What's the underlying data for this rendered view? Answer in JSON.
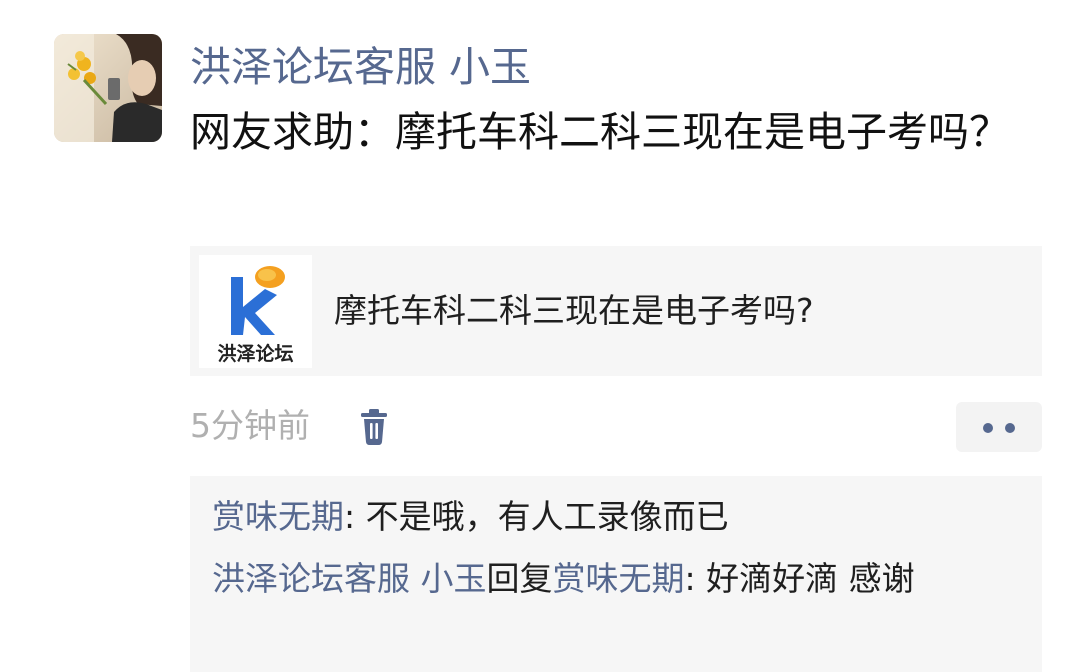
{
  "post": {
    "author": "洪泽论坛客服 小玉",
    "text": "网友求助：摩托车科二科三现在是电子考吗？",
    "avatar_icon": "user-avatar-photo"
  },
  "link_card": {
    "title": "摩托车科二科三现在是电子考吗?",
    "brand_name": "洪泽论坛",
    "logo_icon": "hongze-forum-logo"
  },
  "meta": {
    "time": "5分钟前",
    "delete_icon": "trash-icon",
    "more_icon": "more-dots-icon"
  },
  "comments": [
    {
      "user": "赏味无期",
      "separator": ": ",
      "text": "不是哦，有人工录像而已"
    },
    {
      "user": "洪泽论坛客服 小玉",
      "reply_word": "回复",
      "reply_to": "赏味无期",
      "separator": ": ",
      "text": "好滴好滴 感谢"
    }
  ],
  "colors": {
    "name_blue": "#56688f",
    "card_bg": "#f6f6f6",
    "time_gray": "#b0b0b0",
    "logo_blue": "#2b6fd6",
    "logo_orange": "#f4a020"
  }
}
